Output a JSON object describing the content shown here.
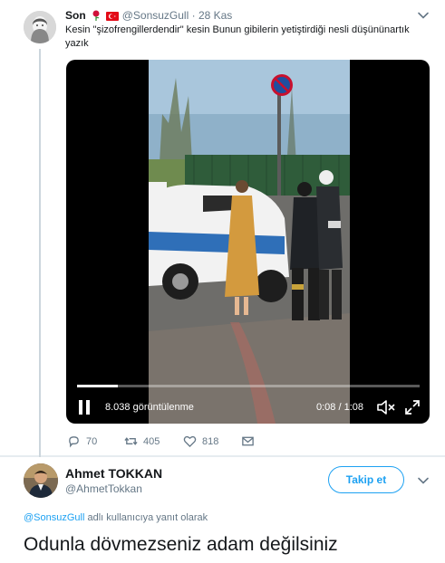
{
  "tweet1": {
    "name": "Son",
    "handle": "@SonsuzGull",
    "separator": "·",
    "date": "28 Kas",
    "text": "Kesin \"şizofrengillerdendir\" kesin Bunun gibilerin yetiştirdiği nesli düşününartık yazık",
    "video": {
      "views": "8.038 görüntülenme",
      "time": "0:08 / 1:08",
      "progress": 0.12
    },
    "actions": {
      "replies": "70",
      "retweets": "405",
      "likes": "818"
    }
  },
  "tweet2": {
    "name": "Ahmet TOKKAN",
    "handle": "@AhmetTokkan",
    "follow_label": "Takip et",
    "replying_mention": "@SonsuzGull",
    "replying_suffix": " adlı kullanıcıya yanıt olarak",
    "text": "Odunla dövmezseniz adam değilsiniz"
  },
  "colors": {
    "accent": "#1da1f2",
    "muted": "#657786",
    "text": "#14171a",
    "background": "#e6ecf0"
  },
  "icons": [
    "rose-emoji",
    "turkey-flag-emoji",
    "chevron-down-icon",
    "pause-icon",
    "volume-icon",
    "fullscreen-icon",
    "reply-icon",
    "retweet-icon",
    "like-icon",
    "message-icon"
  ]
}
